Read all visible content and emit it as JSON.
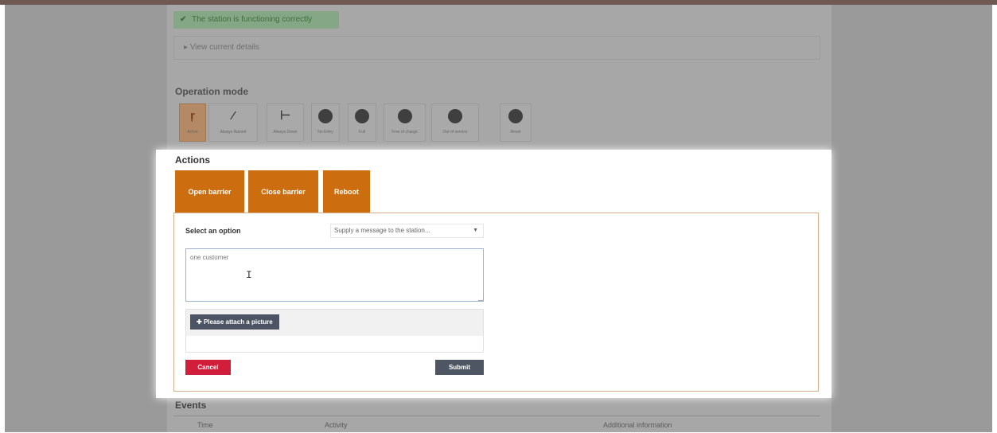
{
  "status": {
    "text": "The station is functioning correctly",
    "icon": "check-icon",
    "color": "#86a786"
  },
  "details": {
    "label": "View current details"
  },
  "operation_mode": {
    "title": "Operation mode",
    "buttons": [
      {
        "label": "Active",
        "icon": "barrier-active-icon",
        "active": true
      },
      {
        "label": "Always Raised",
        "icon": "barrier-raised-icon"
      },
      {
        "label": "Always Down",
        "icon": "barrier-down-icon"
      },
      {
        "label": "No Entry",
        "icon": "no-entry-icon"
      },
      {
        "label": "Full",
        "icon": "full-icon"
      },
      {
        "label": "Free of charge",
        "icon": "free-icon"
      },
      {
        "label": "Out of service",
        "icon": "out-of-service-icon"
      },
      {
        "label": "Reset",
        "icon": "reset-icon"
      }
    ]
  },
  "modal": {
    "title": "Actions",
    "buttons": {
      "open": "Open barrier",
      "close": "Close barrier",
      "reboot": "Reboot"
    },
    "accent": "#cc6e0f",
    "select": {
      "label": "Select an option",
      "value": "Supply a message to the station..."
    },
    "message": {
      "value": "one customer"
    },
    "attach_label": "Please attach a picture",
    "cancel": "Cancel",
    "submit": "Submit"
  },
  "events": {
    "title": "Events",
    "columns": [
      "Time",
      "Activity",
      "Additional information"
    ]
  }
}
